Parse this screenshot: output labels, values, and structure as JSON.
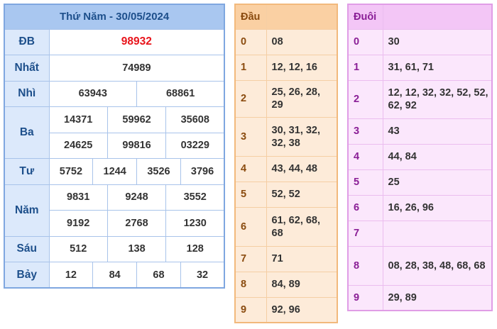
{
  "results": {
    "title": "Thứ Năm - 30/05/2024",
    "db": {
      "label": "ĐB",
      "value": "98932"
    },
    "nhat": {
      "label": "Nhất",
      "value": "74989"
    },
    "nhi": {
      "label": "Nhì",
      "values": [
        "63943",
        "68861"
      ]
    },
    "ba": {
      "label": "Ba",
      "values": [
        "14371",
        "59962",
        "35608",
        "24625",
        "99816",
        "03229"
      ]
    },
    "tu": {
      "label": "Tư",
      "values": [
        "5752",
        "1244",
        "3526",
        "3796"
      ]
    },
    "nam": {
      "label": "Năm",
      "values": [
        "9831",
        "9248",
        "3552",
        "9192",
        "2768",
        "1230"
      ]
    },
    "sau": {
      "label": "Sáu",
      "values": [
        "512",
        "138",
        "128"
      ]
    },
    "bay": {
      "label": "Bảy",
      "values": [
        "12",
        "84",
        "68",
        "32"
      ]
    }
  },
  "dau": {
    "header": "Đầu",
    "rows": [
      {
        "k": "0",
        "v": "08"
      },
      {
        "k": "1",
        "v": "12, 12, 16"
      },
      {
        "k": "2",
        "v": "25, 26, 28, 29"
      },
      {
        "k": "3",
        "v": "30, 31, 32, 32, 38"
      },
      {
        "k": "4",
        "v": "43, 44, 48"
      },
      {
        "k": "5",
        "v": "52, 52"
      },
      {
        "k": "6",
        "v": "61, 62, 68, 68"
      },
      {
        "k": "7",
        "v": "71"
      },
      {
        "k": "8",
        "v": "84, 89"
      },
      {
        "k": "9",
        "v": "92, 96"
      }
    ]
  },
  "duoi": {
    "header": "Đuôi",
    "rows": [
      {
        "k": "0",
        "v": "30"
      },
      {
        "k": "1",
        "v": "31, 61, 71"
      },
      {
        "k": "2",
        "v": "12, 12, 32, 32, 52, 52, 62, 92"
      },
      {
        "k": "3",
        "v": "43"
      },
      {
        "k": "4",
        "v": "44, 84"
      },
      {
        "k": "5",
        "v": "25"
      },
      {
        "k": "6",
        "v": "16, 26, 96"
      },
      {
        "k": "7",
        "v": ""
      },
      {
        "k": "8",
        "v": "08, 28, 38, 48, 68, 68"
      },
      {
        "k": "9",
        "v": "29, 89"
      }
    ]
  }
}
